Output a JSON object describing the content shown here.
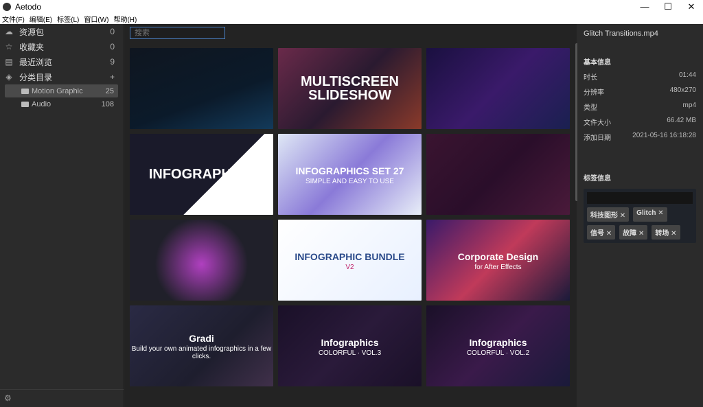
{
  "app": {
    "title": "Aetodo",
    "window_controls": [
      "—",
      "☐",
      "✕"
    ]
  },
  "menu": [
    "文件(F)",
    "编辑(E)",
    "标签(L)",
    "窗口(W)",
    "帮助(H)"
  ],
  "sidebar": {
    "items": [
      {
        "label": "资源包",
        "count": "0",
        "icon": "cloud-icon",
        "glyph": "☁"
      },
      {
        "label": "收藏夹",
        "count": "0",
        "icon": "star-icon",
        "glyph": "☆"
      },
      {
        "label": "最近浏览",
        "count": "9",
        "icon": "history-icon",
        "glyph": "▤"
      },
      {
        "label": "分类目录",
        "count": "+",
        "icon": "layers-icon",
        "glyph": "◈"
      }
    ],
    "folders": [
      {
        "label": "Motion Graphic",
        "count": "25",
        "selected": true
      },
      {
        "label": "Audio",
        "count": "108",
        "selected": false
      }
    ],
    "settings_icon": "gear-icon"
  },
  "search": {
    "placeholder": "搜索"
  },
  "thumbnails": [
    {
      "title": "",
      "subtitle": "",
      "bg": "linear-gradient(160deg,#0f1620,#0b1a2a 60%,#133a5a)"
    },
    {
      "title": "MULTISCREEN SLIDESHOW",
      "subtitle": "",
      "bg": "linear-gradient(135deg,#6a2a4a,#2a1a30 50%,#8a3a2a)"
    },
    {
      "title": "",
      "subtitle": "",
      "bg": "linear-gradient(135deg,#1a1040,#3a1a6a 50%,#1a2050)"
    },
    {
      "title": "INFOGRAPHICS",
      "subtitle": "",
      "bg": "linear-gradient(135deg,#1a1a2a 60%,#ffffff 60%)"
    },
    {
      "title": "INFOGRAPHICS SET 27",
      "subtitle": "SIMPLE AND EASY TO USE",
      "bg": "linear-gradient(135deg,#dfe8f5,#8a7ad8 50%,#e8eef8)"
    },
    {
      "title": "",
      "subtitle": "",
      "bg": "linear-gradient(135deg,#3a1430,#2a0e2a 50%,#4a1a3a)"
    },
    {
      "title": "",
      "subtitle": "",
      "bg": "radial-gradient(circle at 50% 55%,#b040c0,#20202a 55%)"
    },
    {
      "title": "INFOGRAPHIC BUNDLE",
      "subtitle": "V2",
      "bg": "linear-gradient(135deg,#ffffff,#e8f0ff)"
    },
    {
      "title": "Corporate Design",
      "subtitle": "for After Effects",
      "bg": "linear-gradient(135deg,#3a1a6a,#c03a5a 50%,#1a1a3a)"
    },
    {
      "title": "Gradi",
      "subtitle": "Build your own animated infographics in a few clicks.",
      "bg": "linear-gradient(135deg,#2a2a44,#1e1e2e 60%,#40304a)"
    },
    {
      "title": "Infographics",
      "subtitle": "COLORFUL · VOL.3",
      "bg": "linear-gradient(135deg,#1a1028,#2a1a3a 50%,#1a1028)"
    },
    {
      "title": "Infographics",
      "subtitle": "COLORFUL · VOL.2",
      "bg": "linear-gradient(135deg,#1a1028,#3a1a4a 50%,#1a1a3a)"
    }
  ],
  "details": {
    "filename": "Glitch Transitions.mp4",
    "basic_title": "基本信息",
    "fields": [
      {
        "label": "时长",
        "value": "01:44"
      },
      {
        "label": "分辨率",
        "value": "480x270"
      },
      {
        "label": "类型",
        "value": "mp4"
      },
      {
        "label": "文件大小",
        "value": "66.42 MB"
      },
      {
        "label": "添加日期",
        "value": "2021-05-16 16:18:28"
      }
    ],
    "tags_title": "标签信息",
    "tags": [
      "科技图形",
      "Glitch",
      "信号",
      "故障",
      "转场"
    ]
  }
}
